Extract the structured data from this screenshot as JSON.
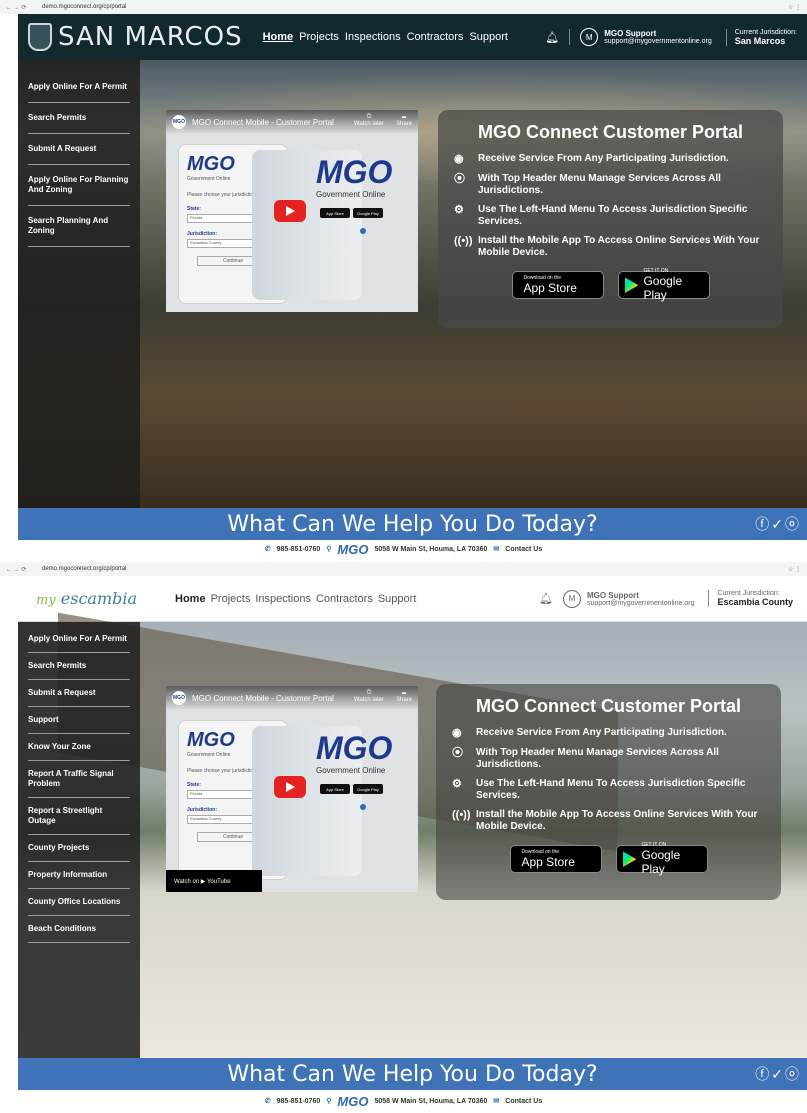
{
  "browser": {
    "url1": "demo.mgoconnect.org/cp/portal",
    "url2": "demo.mgoconnect.org/cp/portal"
  },
  "screen1": {
    "logo": "SAN MARCOS",
    "nav": [
      "Home",
      "Projects",
      "Inspections",
      "Contractors",
      "Support"
    ],
    "user": {
      "initial": "M",
      "name": "MGO Support",
      "email": "support@mygovernmentonline.org"
    },
    "jurisdiction": {
      "label": "Current Jurisdiction:",
      "name": "San Marcos"
    },
    "sidebar": [
      "Apply Online For A Permit",
      "Search Permits",
      "Submit A Request",
      "Apply Online For Planning And Zoning",
      "Search Planning And Zoning"
    ]
  },
  "screen2": {
    "logo_my": "my",
    "logo": "escambia",
    "nav": [
      "Home",
      "Projects",
      "Inspections",
      "Contractors",
      "Support"
    ],
    "user": {
      "initial": "M",
      "name": "MGO Support",
      "email": "support@mygovernmentonline.org"
    },
    "jurisdiction": {
      "label": "Current Jurisdiction:",
      "name": "Escambia County"
    },
    "sidebar": [
      "Apply Online For A Permit",
      "Search Permits",
      "Submit a Request",
      "Support",
      "Know Your Zone",
      "Report A Traffic Signal Problem",
      "Report a Streetlight Outage",
      "County Projects",
      "Property Information",
      "County Office Locations",
      "Beach Conditions"
    ],
    "watch_on": "Watch on ▶ YouTube"
  },
  "video": {
    "title": "MGO Connect Mobile - Customer Portal",
    "watch_later": "Watch later",
    "share": "Share",
    "mgo": "MGO",
    "gov_online": "Government Online",
    "choose": "Please choose your jurisdiction",
    "state_label": "State:",
    "state_val": "Florida",
    "jur_label": "Jurisdiction:",
    "jur_val": "Escambia County",
    "continue": "Continue"
  },
  "portal": {
    "title": "MGO Connect Customer Portal",
    "items": [
      "Receive Service From Any Participating Jurisdiction.",
      "With Top Header Menu Manage Services Across All Jurisdictions.",
      "Use The Left-Hand Menu To Access Jurisdiction Specific Services.",
      "Install the Mobile App To Access Online Services With Your Mobile Device."
    ],
    "icons": [
      "globe-icon",
      "pin-icon",
      "user-gear-icon",
      "broadcast-icon"
    ],
    "appstore_small": "Download on the",
    "appstore": "App Store",
    "googleplay_small": "GET IT ON",
    "googleplay": "Google Play"
  },
  "help": {
    "text": "What Can We Help You Do Today?"
  },
  "footer": {
    "phone": "985-851-0760",
    "address": "5058 W Main St, Houma, LA 70360",
    "contact": "Contact Us"
  }
}
